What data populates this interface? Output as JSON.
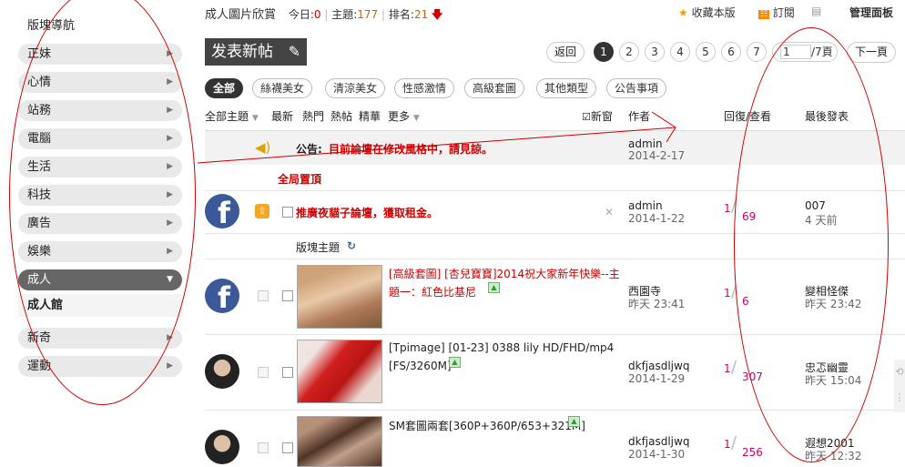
{
  "sidebar": {
    "title": "版塊導航",
    "items": [
      "正妹",
      "心情",
      "站務",
      "電腦",
      "生活",
      "科技",
      "廣告",
      "娛樂",
      "成人",
      "新奇",
      "運動"
    ],
    "active": "成人",
    "sub": "成人館"
  },
  "top": {
    "forum": "成人圖片欣賞",
    "today_label": "今日:",
    "today": "0",
    "topics_label": "主題:",
    "topics": "177",
    "rank_label": "排名:",
    "rank": "21",
    "fav": "收藏本版",
    "rss": "訂閱",
    "manage": "管理面板"
  },
  "post_btn": "发表新帖",
  "pager": {
    "back": "返回",
    "pages": [
      "1",
      "2",
      "3",
      "4",
      "5",
      "6",
      "7"
    ],
    "input": "1",
    "total": "/7頁",
    "next": "下一頁"
  },
  "tabs": [
    "全部",
    "絲襪美女",
    "清涼美女",
    "性感激情",
    "高級套圖",
    "其他類型",
    "公告事項"
  ],
  "filters": {
    "all": "全部主題",
    "newest": "最新",
    "hot": "熱門",
    "hotpost": "熱帖",
    "digest": "精華",
    "more": "更多",
    "newwin": "新窗",
    "author": "作者",
    "replies": "回復/查看",
    "last": "最後發表"
  },
  "announce": {
    "label": "公告:",
    "text": "目前論壇在修改風格中，請見諒。",
    "author": "admin",
    "date": "2014-2-17"
  },
  "global_top": "全局置頂",
  "sticky": {
    "title": "推廣夜貓子論壇，獲取租金。",
    "author": "admin",
    "date": "2014-1-22",
    "replies": "1",
    "views": "69",
    "last_user": "007",
    "last_time": "4 天前"
  },
  "section": "版塊主題",
  "threads": [
    {
      "title1": "[高級套圖] [杏兒寶寶]2014祝大家新年快樂--主",
      "title2": "題一：紅色比基尼",
      "author": "西園寺",
      "date": "昨天 23:41",
      "replies": "1",
      "views": "6",
      "last_user": "變相怪傑",
      "last_time": "昨天 23:42"
    },
    {
      "title1": "[Tpimage] [01-23] 0388 lily HD/FHD/mp4",
      "title2": "[FS/3260M]",
      "author": "dkfjasdljwq",
      "date": "2014-1-29",
      "replies": "1",
      "views": "307",
      "last_user": "忠忑幽靈",
      "last_time": "昨天 15:04"
    },
    {
      "title1": "SM套圖兩套[360P+360P/653+321M]",
      "title2": "",
      "author": "dkfjasdljwq",
      "date": "2014-1-30",
      "replies": "1",
      "views": "256",
      "last_user": "遐想2001",
      "last_time": "昨天 12:32"
    }
  ]
}
